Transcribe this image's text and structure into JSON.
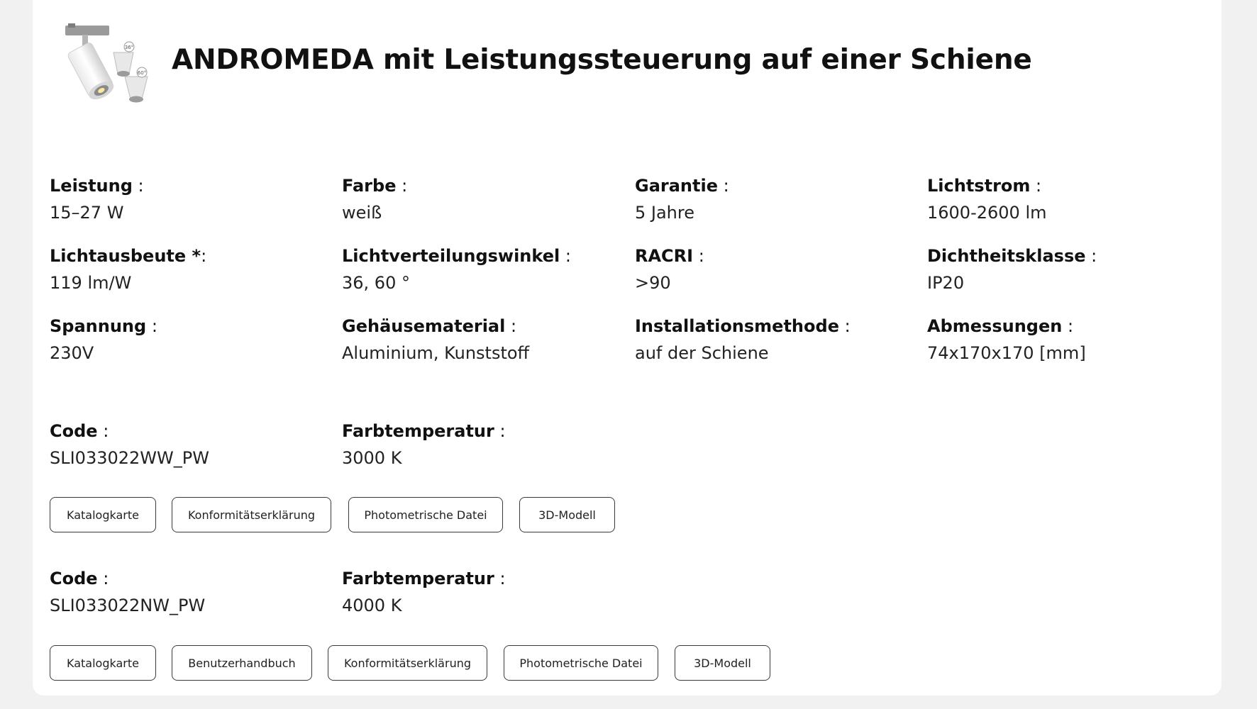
{
  "product": {
    "title": "ANDROMEDA mit Leistungssteuerung auf einer Schiene",
    "image_icon": "track-spotlight-product-image"
  },
  "specs": [
    {
      "label": "Leistung",
      "suffix": " :",
      "value": "15–27 W"
    },
    {
      "label": "Farbe",
      "suffix": " :",
      "value": "weiß"
    },
    {
      "label": "Garantie",
      "suffix": " :",
      "value": "5 Jahre"
    },
    {
      "label": "Lichtstrom",
      "suffix": " :",
      "value": "1600-2600 lm"
    },
    {
      "label": "Lichtausbeute *",
      "suffix": ":",
      "value": "119 lm/W"
    },
    {
      "label": "Lichtverteilungswinkel",
      "suffix": " :",
      "value": "36, 60 °"
    },
    {
      "label": "RACRI",
      "suffix": " :",
      "value": ">90"
    },
    {
      "label": "Dichtheitsklasse",
      "suffix": " :",
      "value": "IP20"
    },
    {
      "label": "Spannung",
      "suffix": " :",
      "value": "230V"
    },
    {
      "label": "Gehäusematerial",
      "suffix": " :",
      "value": "Aluminium, Kunststoff"
    },
    {
      "label": "Installationsmethode",
      "suffix": " :",
      "value": "auf der Schiene"
    },
    {
      "label": "Abmessungen",
      "suffix": " :",
      "value": "74x170x170 [mm]"
    }
  ],
  "variants": [
    {
      "code_label": "Code",
      "code_suffix": " :",
      "code": "SLI033022WW_PW",
      "temp_label": "Farbtemperatur",
      "temp_suffix": " :",
      "temp": "3000 K",
      "buttons": [
        "Katalogkarte",
        "Konformitätserklärung",
        "Photometrische Datei",
        "3D-Modell"
      ]
    },
    {
      "code_label": "Code",
      "code_suffix": " :",
      "code": "SLI033022NW_PW",
      "temp_label": "Farbtemperatur",
      "temp_suffix": " :",
      "temp": "4000 K",
      "buttons": [
        "Katalogkarte",
        "Benutzerhandbuch",
        "Konformitätserklärung",
        "Photometrische Datei",
        "3D-Modell"
      ]
    }
  ],
  "colors": {
    "page_bg": "#f1f1f1",
    "card_bg": "#ffffff",
    "text": "#111111",
    "button_border": "#3a3a3a"
  }
}
